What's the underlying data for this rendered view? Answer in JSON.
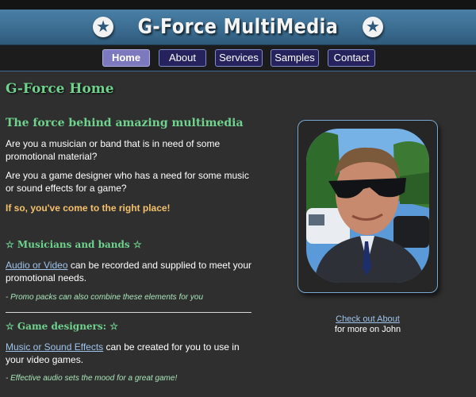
{
  "header": {
    "title": "G-Force MultiMedia"
  },
  "nav": {
    "items": [
      {
        "label": "Home",
        "active": true
      },
      {
        "label": "About",
        "active": false
      },
      {
        "label": "Services",
        "active": false
      },
      {
        "label": "Samples",
        "active": false
      },
      {
        "label": "Contact",
        "active": false
      }
    ]
  },
  "main": {
    "page_title": "G-Force Home",
    "tagline": "The force behind amazing multimedia",
    "intro_1": "Are you a musician or band that is in need of some promotional material?",
    "intro_2": "Are you a game designer who has a need for some music or sound effects for a game?",
    "callout": "If so, you've come to the right place!",
    "musicians": {
      "heading": "☆ Musicians and bands ☆",
      "link": "Audio or Video",
      "text": " can be recorded and supplied to meet your promotional needs.",
      "note": "- Promo packs can also combine these elements for you"
    },
    "games": {
      "heading": "☆ Game designers: ☆",
      "link": "Music or Sound Effects",
      "text": " can be created for you to use in your video games.",
      "note": "- Effective audio sets the mood for a great game!"
    }
  },
  "sidebar": {
    "link": "Check out About",
    "text": "for more on John"
  },
  "colors": {
    "background": "#2f2f2f",
    "banner": "#3a6b8f",
    "heading_green": "#6fd38e",
    "callout_orange": "#f5c16c",
    "link_blue": "#9ec3ec",
    "nav_button": "#25225e",
    "nav_active": "#7d79be"
  },
  "icons": {
    "banner_star": "star-circle-icon"
  }
}
